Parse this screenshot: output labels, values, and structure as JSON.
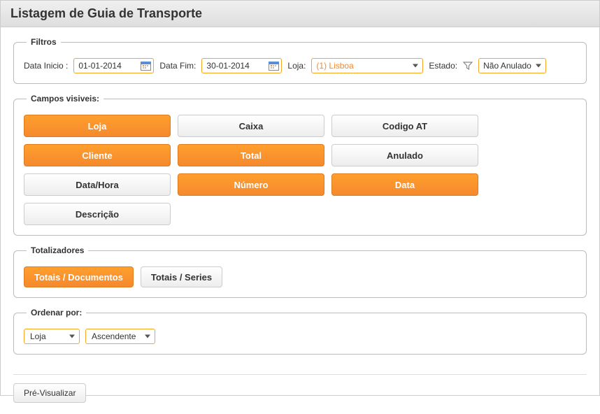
{
  "title": "Listagem de Guia de Transporte",
  "filters": {
    "legend": "Filtros",
    "data_inicio_label": "Data Inicio :",
    "data_inicio_value": "01-01-2014",
    "data_fim_label": "Data Fim:",
    "data_fim_value": "30-01-2014",
    "loja_label": "Loja:",
    "loja_value": "(1) Lisboa",
    "estado_label": "Estado:",
    "estado_value": "Não Anulado"
  },
  "fields": {
    "legend": "Campos visiveis:",
    "items": [
      {
        "label": "Loja",
        "active": true
      },
      {
        "label": "Caixa",
        "active": false
      },
      {
        "label": "Codigo AT",
        "active": false
      },
      {
        "label": "Cliente",
        "active": true
      },
      {
        "label": "Total",
        "active": true
      },
      {
        "label": "Anulado",
        "active": false
      },
      {
        "label": "Data/Hora",
        "active": false
      },
      {
        "label": "Número",
        "active": true
      },
      {
        "label": "Data",
        "active": true
      },
      {
        "label": "Descrição",
        "active": false
      }
    ]
  },
  "totals": {
    "legend": "Totalizadores",
    "items": [
      {
        "label": "Totais / Documentos",
        "active": true
      },
      {
        "label": "Totais / Series",
        "active": false
      }
    ]
  },
  "order": {
    "legend": "Ordenar por:",
    "field_value": "Loja",
    "direction_value": "Ascendente"
  },
  "preview_label": "Pré-Visualizar"
}
